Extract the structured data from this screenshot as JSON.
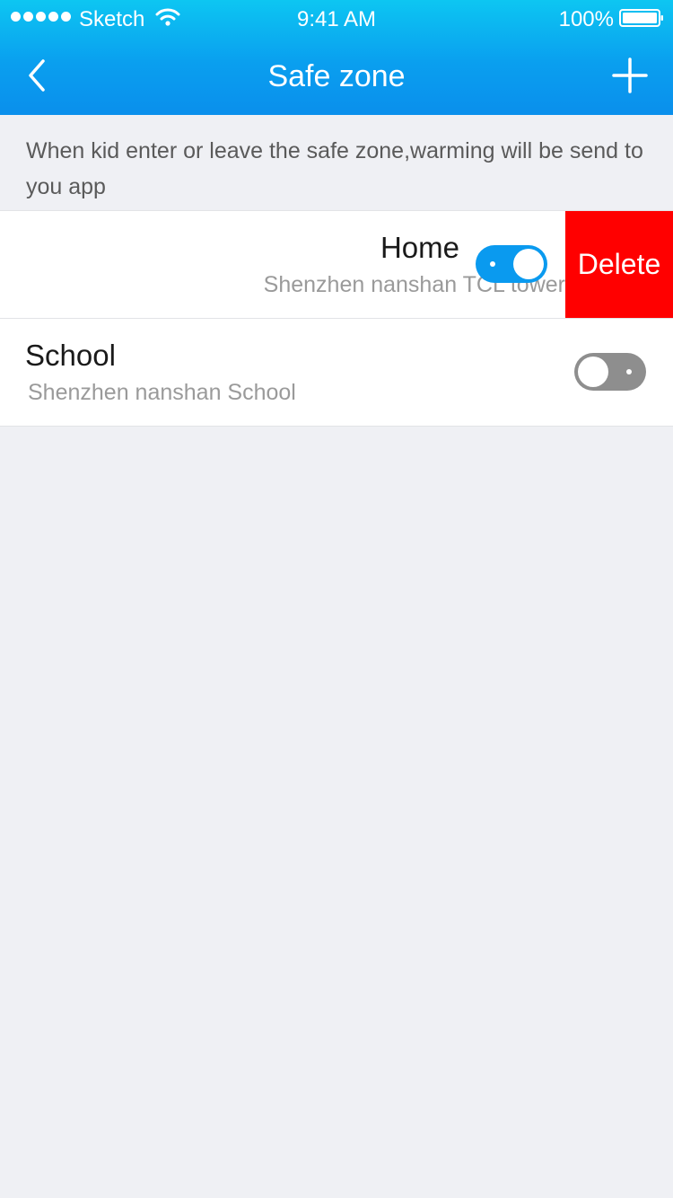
{
  "status_bar": {
    "carrier": "Sketch",
    "time": "9:41 AM",
    "battery": "100%",
    "signal_icon": "signal-dots-icon",
    "wifi_icon": "wifi-icon",
    "battery_icon": "battery-icon"
  },
  "navbar": {
    "title": "Safe zone",
    "back_icon": "chevron-left-icon",
    "add_icon": "plus-icon"
  },
  "notice": "When kid enter or leave the safe zone,warming will be send to you app",
  "zones": [
    {
      "name": "Home",
      "address": "Shenzhen nanshan TCL tower",
      "enabled": true,
      "swiped_open": true,
      "delete_label": "Delete"
    },
    {
      "name": "School",
      "address": "Shenzhen nanshan School",
      "enabled": false,
      "swiped_open": false
    }
  ],
  "colors": {
    "header_top": "#0dc6f2",
    "header_bottom": "#0a8fec",
    "toggle_on": "#0a9aef",
    "toggle_off": "#8e8e8e",
    "delete": "#ff0000",
    "background": "#eff0f4"
  }
}
